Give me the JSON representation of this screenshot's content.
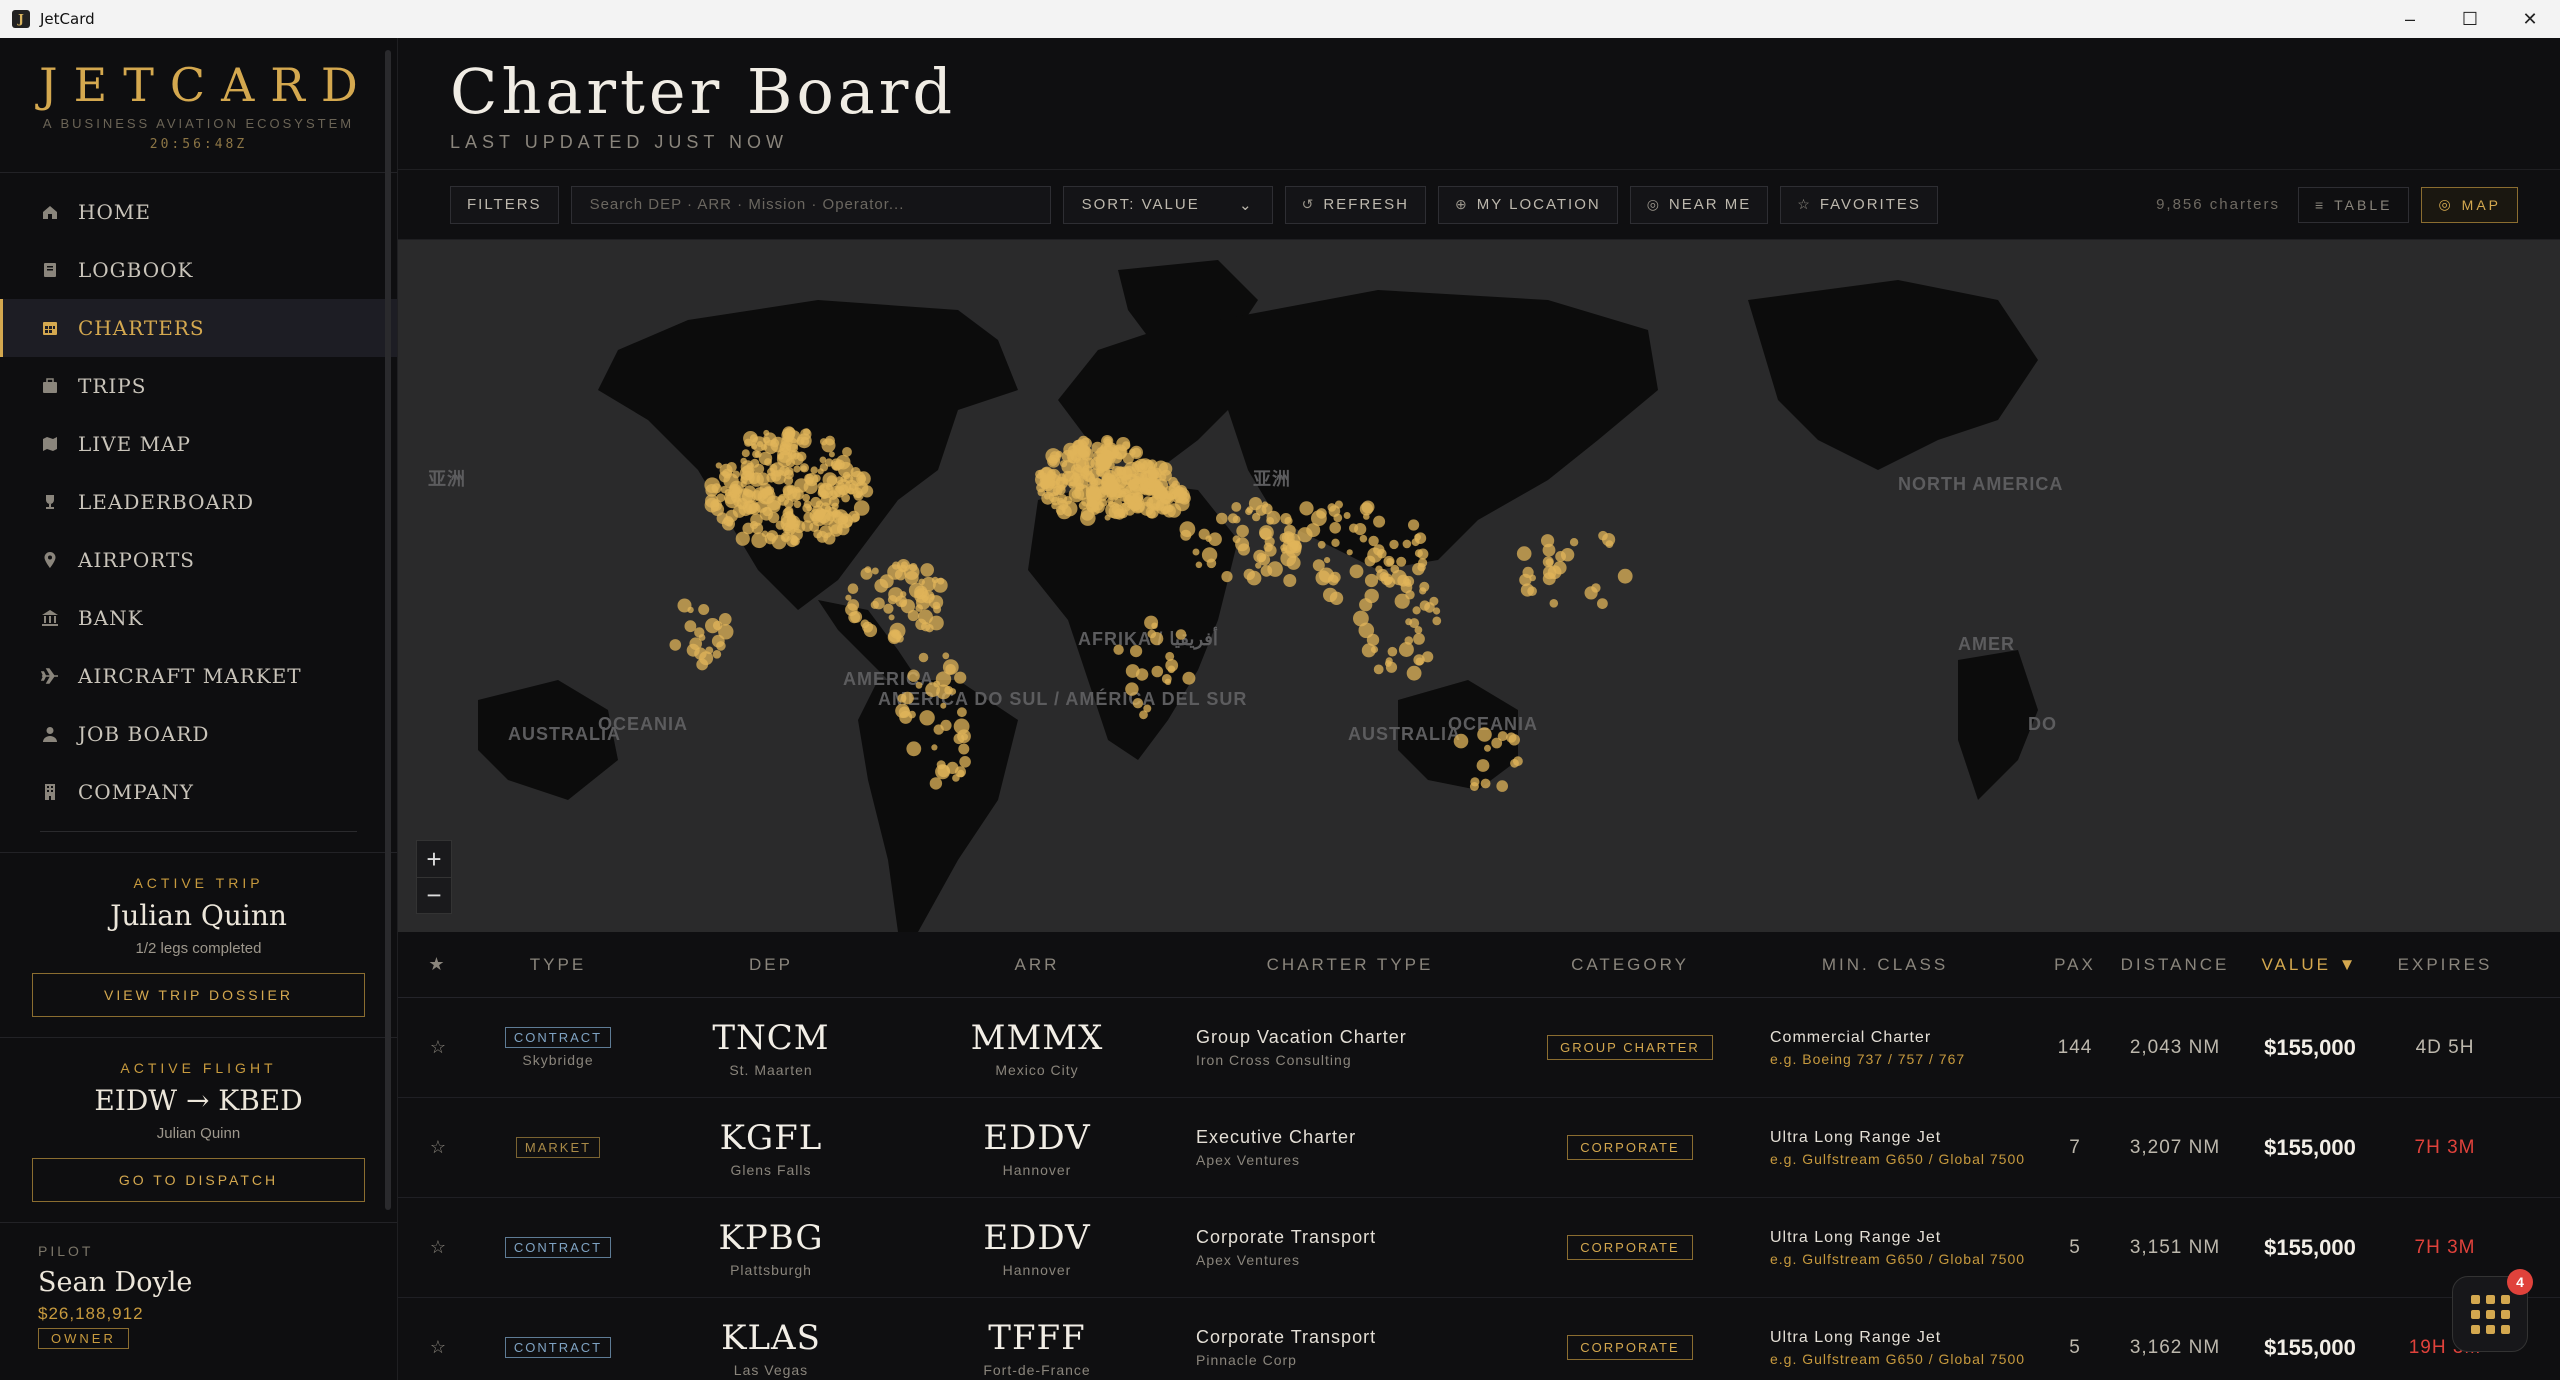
{
  "window": {
    "title": "JetCard",
    "controls": [
      "–",
      "☐",
      "✕"
    ]
  },
  "sidebar": {
    "brand": "JETCARD",
    "tagline": "A BUSINESS AVIATION ECOSYSTEM",
    "clock": "20:56:48Z",
    "items": [
      {
        "label": "HOME",
        "icon": "home-icon"
      },
      {
        "label": "LOGBOOK",
        "icon": "book-icon"
      },
      {
        "label": "CHARTERS",
        "icon": "calendar-icon"
      },
      {
        "label": "TRIPS",
        "icon": "suitcase-icon"
      },
      {
        "label": "LIVE MAP",
        "icon": "map-icon"
      },
      {
        "label": "LEADERBOARD",
        "icon": "trophy-icon"
      },
      {
        "label": "AIRPORTS",
        "icon": "pin-icon"
      },
      {
        "label": "BANK",
        "icon": "bank-icon"
      },
      {
        "label": "AIRCRAFT MARKET",
        "icon": "plane-icon"
      },
      {
        "label": "JOB BOARD",
        "icon": "person-icon"
      },
      {
        "label": "COMPANY",
        "icon": "building-icon"
      }
    ],
    "active_item": "CHARTERS",
    "active_trip": {
      "label": "ACTIVE TRIP",
      "name": "Julian Quinn",
      "progress": "1/2 legs completed",
      "button": "VIEW TRIP DOSSIER"
    },
    "active_flight": {
      "label": "ACTIVE FLIGHT",
      "route": "EIDW → KBED",
      "pilot": "Julian Quinn",
      "button": "GO TO DISPATCH"
    },
    "pilot": {
      "label": "PILOT",
      "name": "Sean Doyle",
      "money": "$26,188,912",
      "role": "OWNER"
    }
  },
  "header": {
    "title": "Charter Board",
    "updated": "LAST UPDATED JUST NOW"
  },
  "toolbar": {
    "filters": "FILTERS",
    "search_placeholder": "Search DEP · ARR · Mission · Operator...",
    "sort": "SORT: VALUE",
    "refresh": "REFRESH",
    "my_location": "MY LOCATION",
    "near_me": "NEAR ME",
    "favorites": "FAVORITES",
    "count": "9,856 charters",
    "table": "TABLE",
    "map": "MAP",
    "active_view": "MAP"
  },
  "map": {
    "labels": [
      "亚洲",
      "亚洲",
      "AMERICA",
      "AFRIKA / أفريقيا",
      "AMERICA DO SUL / AMÉRICA DEL SUR",
      "AUSTRALIA",
      "OCEANIA",
      "AUSTRALIA",
      "OCEANIA",
      "NORTH AMERICA",
      "AMER",
      "DO"
    ],
    "zoom_in": "+",
    "zoom_out": "−",
    "marker_color": "#e0b45a"
  },
  "table": {
    "columns": [
      "★",
      "TYPE",
      "DEP",
      "ARR",
      "CHARTER TYPE",
      "CATEGORY",
      "MIN. CLASS",
      "PAX",
      "DISTANCE",
      "VALUE ▼",
      "EXPIRES"
    ],
    "rows": [
      {
        "type": "CONTRACT",
        "operator": "Skybridge",
        "dep": "TNCM",
        "dep_city": "St. Maarten",
        "arr": "MMMX",
        "arr_city": "Mexico City",
        "charter_type": "Group Vacation Charter",
        "client": "Iron Cross Consulting",
        "category": "GROUP CHARTER",
        "min_class": "Commercial Charter",
        "example": "e.g. Boeing 737 / 757 / 767",
        "pax": "144",
        "distance": "2,043 NM",
        "value": "$155,000",
        "expires": "4D 5H",
        "urgent": false
      },
      {
        "type": "MARKET",
        "operator": "",
        "dep": "KGFL",
        "dep_city": "Glens Falls",
        "arr": "EDDV",
        "arr_city": "Hannover",
        "charter_type": "Executive Charter",
        "client": "Apex Ventures",
        "category": "CORPORATE",
        "min_class": "Ultra Long Range Jet",
        "example": "e.g. Gulfstream G650 / Global 7500",
        "pax": "7",
        "distance": "3,207 NM",
        "value": "$155,000",
        "expires": "7H 3M",
        "urgent": true
      },
      {
        "type": "CONTRACT",
        "operator": "",
        "dep": "KPBG",
        "dep_city": "Plattsburgh",
        "arr": "EDDV",
        "arr_city": "Hannover",
        "charter_type": "Corporate Transport",
        "client": "Apex Ventures",
        "category": "CORPORATE",
        "min_class": "Ultra Long Range Jet",
        "example": "e.g. Gulfstream G650 / Global 7500",
        "pax": "5",
        "distance": "3,151 NM",
        "value": "$155,000",
        "expires": "7H 3M",
        "urgent": true
      },
      {
        "type": "CONTRACT",
        "operator": "",
        "dep": "KLAS",
        "dep_city": "Las Vegas",
        "arr": "TFFF",
        "arr_city": "Fort-de-France",
        "charter_type": "Corporate Transport",
        "client": "Pinnacle Corp",
        "category": "CORPORATE",
        "min_class": "Ultra Long Range Jet",
        "example": "e.g. Gulfstream G650 / Global 7500",
        "pax": "5",
        "distance": "3,162 NM",
        "value": "$155,000",
        "expires": "19H 3M",
        "urgent": true
      }
    ]
  },
  "fab": {
    "badge": "4"
  }
}
